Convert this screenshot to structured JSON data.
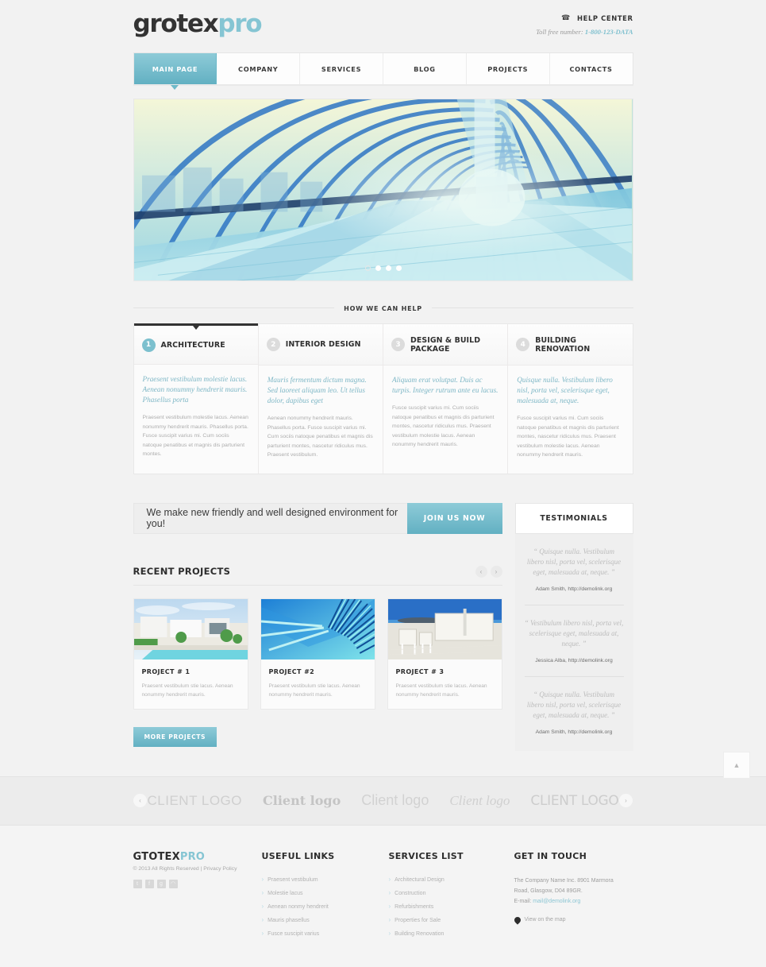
{
  "header": {
    "logo_primary": "grotex",
    "logo_accent": "pro",
    "help_title": "HELP CENTER",
    "phone_icon": "phone-icon",
    "tollfree_label": "Toll free number: ",
    "tollfree_number": "1-800-123-DATA"
  },
  "nav": {
    "items": [
      {
        "label": "MAIN PAGE",
        "active": true
      },
      {
        "label": "COMPANY",
        "active": false
      },
      {
        "label": "SERVICES",
        "active": false
      },
      {
        "label": "BLOG",
        "active": false
      },
      {
        "label": "PROJECTS",
        "active": false
      },
      {
        "label": "CONTACTS",
        "active": false
      }
    ]
  },
  "hero": {
    "alt": "glass tunnel walkway",
    "dots": [
      {
        "active": false
      },
      {
        "active": true
      },
      {
        "active": true
      },
      {
        "active": true
      }
    ]
  },
  "how_we_can_help": {
    "section_title": "HOW WE CAN HELP",
    "services": [
      {
        "num": "1",
        "name": "ARCHITECTURE",
        "lead": "Praesent vestibulum molestie lacus. Aenean nonummy hendrerit mauris. Phasellus porta",
        "text": "Praesent vestibulum molestie lacus. Aenean nonummy hendrerit mauris. Phasellus porta. Fusce suscipit varius mi. Cum sociis natoque penatibus et magnis dis parturient montes.",
        "active": true
      },
      {
        "num": "2",
        "name": "INTERIOR DESIGN",
        "lead": "Mauris fermentum dictum magna. Sed laoreet aliquam leo. Ut tellus dolor, dapibus eget",
        "text": "Aenean nonummy hendrerit mauris. Phasellus porta. Fusce suscipit varius mi. Cum sociis natoque penatibus et magnis dis parturient montes, nascetur ridiculus mus. Praesent vestibulum.",
        "active": false
      },
      {
        "num": "3",
        "name": "DESIGN & BUILD PACKAGE",
        "lead": "Aliquam erat volutpat. Duis ac turpis. Integer rutrum ante eu lacus.",
        "text": "Fusce suscipit varius mi. Cum sociis natoque penatibus et magnis dis parturient montes, nascetur ridiculus mus. Praesent vestibulum molestie lacus. Aenean nonummy hendrerit mauris.",
        "active": false
      },
      {
        "num": "4",
        "name": "BUILDING RENOVATION",
        "lead": "Quisque nulla. Vestibulum libero nisl, porta vel, scelerisque eget, malesuada at, neque.",
        "text": "Fusce suscipit varius mi. Cum sociis natoque penatibus et magnis dis parturient montes, nascetur ridiculus mus. Praesent vestibulum molestie lacus. Aenean nonummy hendrerit mauris.",
        "active": false
      }
    ]
  },
  "cta": {
    "text": "We make new friendly and well designed environment for you!",
    "button_label": "JOIN US NOW"
  },
  "recent_projects": {
    "title": "RECENT PROJECTS",
    "prev_icon": "chevron-left-icon",
    "next_icon": "chevron-right-icon",
    "more_button": "MORE PROJECTS",
    "items": [
      {
        "name": "PROJECT # 1",
        "text": "Praesent vestibulum stie lacus. Aenean nonummy hendrerit mauris.",
        "alt": "house with swimming pool"
      },
      {
        "name": "PROJECT #2",
        "text": "Praesent vestibulum stie lacus. Aenean nonummy hendrerit mauris.",
        "alt": "blue modern architecture"
      },
      {
        "name": "PROJECT # 3",
        "text": "Praesent vestibulum stie lacus. Aenean nonummy hendrerit mauris.",
        "alt": "seaside white terrace"
      }
    ]
  },
  "testimonials": {
    "title": "TESTIMONIALS",
    "items": [
      {
        "quote": "“ Quisque nulla. Vestibulum libero nisl, porta vel, scelerisque eget, malesuada at, neque. ”",
        "author": "Adam Smith, http://demolink.org"
      },
      {
        "quote": "“ Vestibulum libero nisl, porta vel, scelerisque eget, malesuada at, neque. ”",
        "author": "Jessica Alba, http://demolink.org"
      },
      {
        "quote": "“ Quisque nulla. Vestibulum libero nisl, porta vel, scelerisque eget, malesuada at, neque. ”",
        "author": "Adam Smith, http://demolink.org"
      }
    ]
  },
  "clients": {
    "prev_icon": "chevron-left-icon",
    "next_icon": "chevron-right-icon",
    "logos": [
      "CLIENT LOGO",
      "Client logo",
      "Client logo",
      "Client logo",
      "CLIENT LOGO"
    ]
  },
  "footer": {
    "brand_primary": "GTOTEX",
    "brand_accent": "PRO",
    "copyright": "© 2013 All Rights Reserved | Privacy Policy",
    "socials": [
      {
        "name": "twitter-icon",
        "glyph": "t"
      },
      {
        "name": "facebook-icon",
        "glyph": "f"
      },
      {
        "name": "google-plus-icon",
        "glyph": "g"
      },
      {
        "name": "rss-icon",
        "glyph": "◠"
      }
    ],
    "useful_links": {
      "title": "USEFUL LINKS",
      "items": [
        "Praesent vestibulum",
        "Molestie lacus",
        "Aenean nonmy hendrerit",
        "Mauris phasellus",
        "Fusce suscipit varius"
      ]
    },
    "services_list": {
      "title": "SERVICES LIST",
      "items": [
        "Architectural Design",
        "Construction",
        "Refurbishments",
        "Properties for Sale",
        "Building Renovation"
      ]
    },
    "get_in_touch": {
      "title": "GET IN TOUCH",
      "address": "The Company Name Inc. 8901 Marmora Road, Glasgow, D04 89GR.",
      "email_label": "E-mail: ",
      "email": "mail@demolink.org",
      "map_icon": "map-pin-icon",
      "map_label": "View on the map"
    }
  },
  "scroll_top": {
    "icon": "chevron-up-icon"
  },
  "colors": {
    "accent": "#7cc0ce",
    "accent_dark": "#62b0c2",
    "page_bg": "#f2f2f2",
    "text_dark": "#2d2d2d",
    "text_muted": "#b2b2b2"
  }
}
